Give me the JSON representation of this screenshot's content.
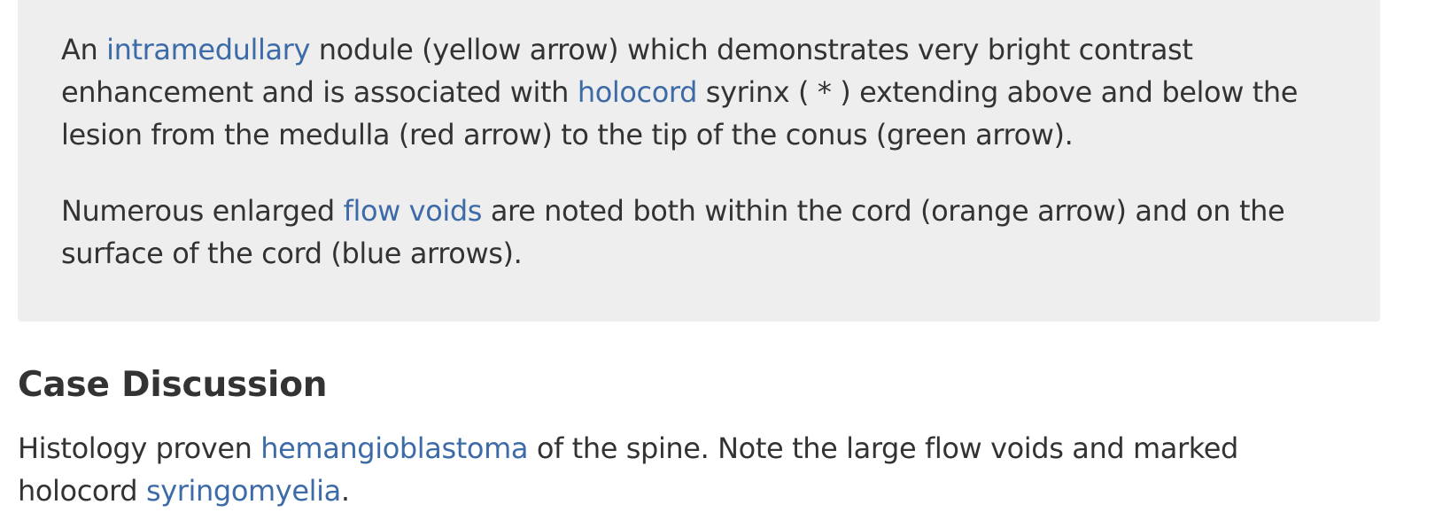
{
  "findings": {
    "p1": {
      "t1": "An ",
      "link1": "intramedullary",
      "t2": " nodule (yellow arrow) which demonstrates very bright contrast enhancement and is associated with ",
      "link2": "holocord",
      "t3": " syrinx ( * ) extending above and below the lesion from the medulla (red arrow) to the tip of the conus (green arrow)."
    },
    "p2": {
      "t1": "Numerous enlarged ",
      "link1": "flow voids",
      "t2": " are noted both within the cord (orange arrow) and on the surface of the cord (blue arrows)."
    }
  },
  "case_discussion": {
    "title": "Case Discussion",
    "t1": "Histology proven ",
    "link1": "hemangioblastoma",
    "t2": " of the spine. Note the large flow voids and marked holocord ",
    "link2": "syringomyelia",
    "t3": "."
  },
  "colors": {
    "link": "#3d6ba8",
    "text": "#333333",
    "box_background": "#eeeeee"
  }
}
